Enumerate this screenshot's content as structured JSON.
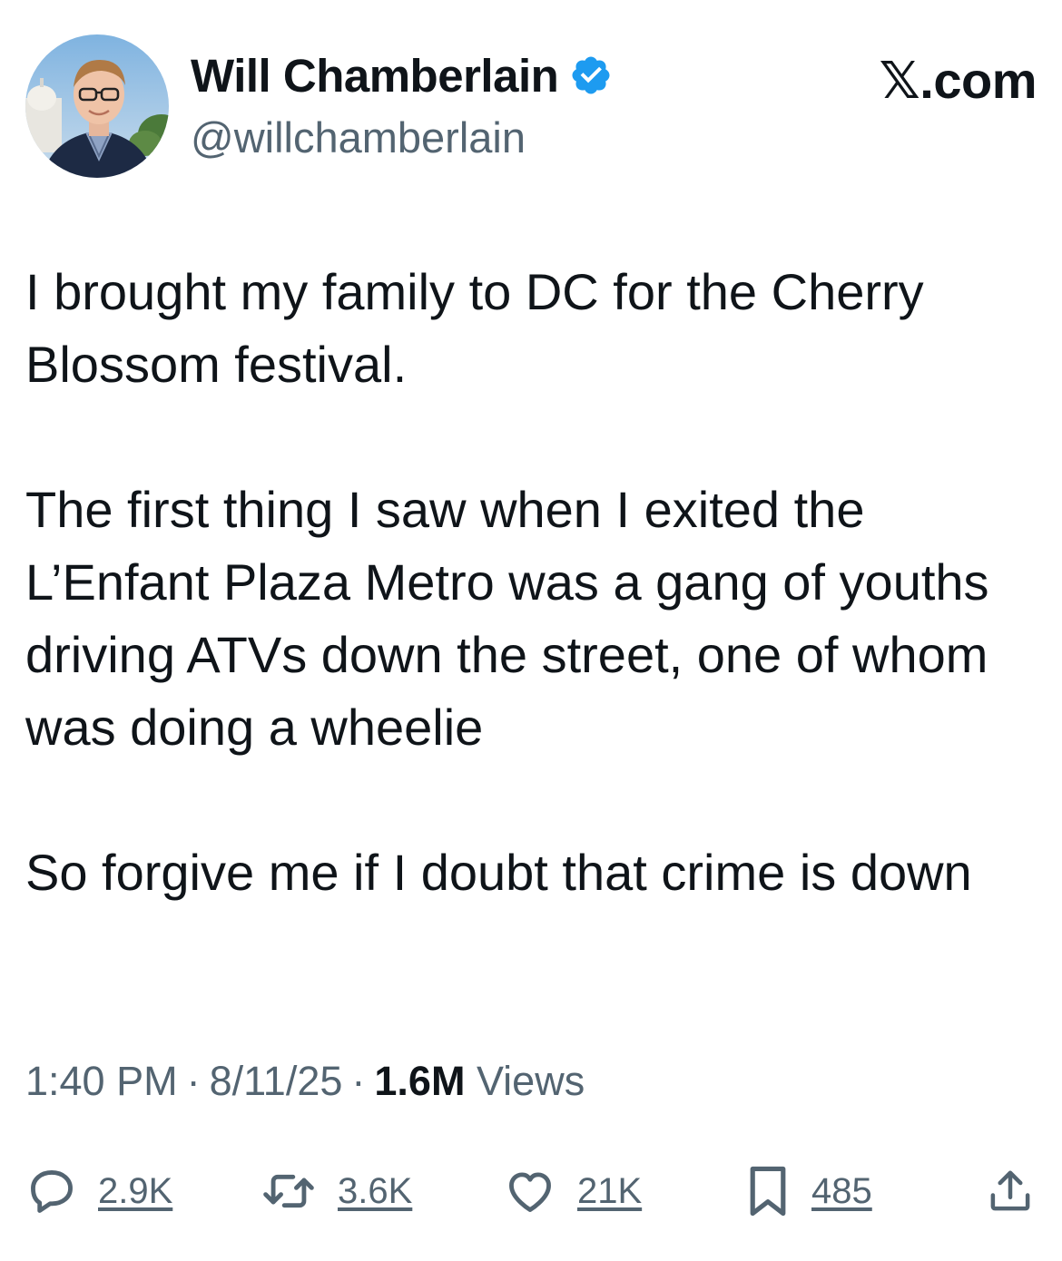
{
  "author": {
    "display_name": "Will Chamberlain",
    "handle": "@willchamberlain",
    "verified": true
  },
  "brand": "𝕏.com",
  "tweet": {
    "paragraphs": [
      "I brought my family to DC for the Cherry Blossom festival.",
      "The first thing I saw when I exited the L’Enfant Plaza Metro was a gang of youths driving ATVs down the street, one of whom was doing a wheelie",
      "So forgive me if I doubt that crime is down"
    ]
  },
  "meta": {
    "time": "1:40 PM",
    "separator": "·",
    "date": "8/11/25",
    "views_count": "1.6M",
    "views_label": "Views"
  },
  "actions": {
    "replies": "2.9K",
    "reposts": "3.6K",
    "likes": "21K",
    "bookmarks": "485"
  },
  "colors": {
    "text_primary": "#0f1419",
    "text_secondary": "#536471",
    "verified_blue": "#1d9bf0",
    "background": "#ffffff"
  },
  "icons": {
    "reply": "speech-bubble-icon",
    "repost": "repost-arrows-icon",
    "like": "heart-icon",
    "bookmark": "bookmark-icon",
    "share": "share-upload-icon",
    "verified": "verified-badge-icon"
  }
}
